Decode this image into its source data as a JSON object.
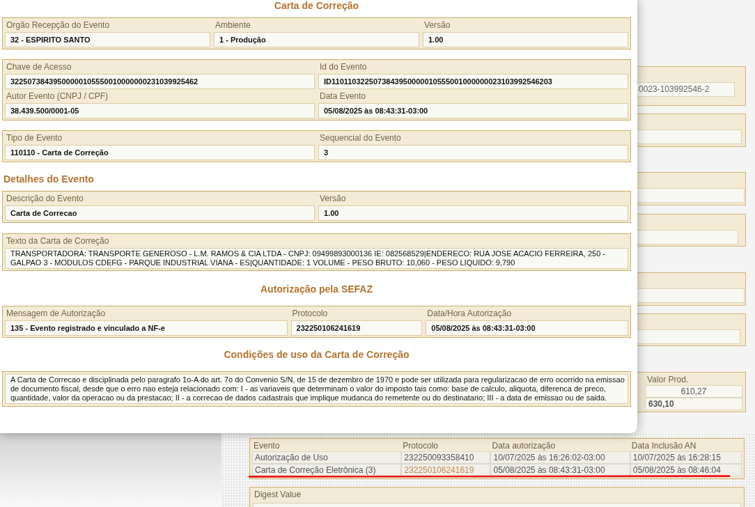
{
  "modal": {
    "title": "Carta de Correção",
    "blocks": [
      {
        "kind": "panel",
        "rows": [
          [
            {
              "kind": "input",
              "label": "Orgão Recepção do Evento",
              "value": "32 - ESPIRITO SANTO"
            },
            {
              "kind": "input",
              "label": "Ambiente",
              "value": "1 - Produção"
            },
            {
              "kind": "input",
              "label": "Versão",
              "value": "1.00"
            }
          ]
        ]
      },
      {
        "kind": "panel",
        "rows": [
          [
            {
              "kind": "input",
              "label": "Chave de Acesso",
              "value": "32250738439500000105550010000000231039925462"
            },
            {
              "kind": "input",
              "label": "Id do Evento",
              "value": "ID1101103225073843950000010555001000000023103992546203"
            }
          ],
          [
            {
              "kind": "input",
              "label": "Autor Evento (CNPJ / CPF)",
              "value": "38.439.500/0001-05"
            },
            {
              "kind": "input",
              "label": "Data Evento",
              "value": "05/08/2025 às 08:43:31-03:00"
            }
          ]
        ]
      },
      {
        "kind": "panel",
        "rows": [
          [
            {
              "kind": "input",
              "label": "Tipo de Evento",
              "value": "110110 - Carta de Correção"
            },
            {
              "kind": "input",
              "label": "Sequencial do Evento",
              "value": "3"
            }
          ]
        ]
      },
      {
        "kind": "heading",
        "text": "Detalhes do Evento"
      },
      {
        "kind": "panel",
        "rows": [
          [
            {
              "kind": "input",
              "label": "Descrição do Evento",
              "value": "Carta de Correcao"
            },
            {
              "kind": "input",
              "label": "Versão",
              "value": "1.00"
            }
          ]
        ]
      },
      {
        "kind": "panel",
        "rows": [
          [
            {
              "kind": "textarea",
              "label": "Texto da Carta de Correção",
              "value": "TRANSPORTADORA: TRANSPORTE GENEROSO - L.M. RAMOS & CIA LTDA - CNPJ: 09499893000136 IE: 082568529|ENDERECO: RUA JOSE ACACIO FERREIRA, 250 - GALPAO 3 - MODULOS CDEFG - PARQUE INDUSTRIAL VIANA - ES|QUANTIDADE: 1 VOLUME - PESO BRUTO: 10,060 - PESO LIQUIDO: 9,790"
            }
          ]
        ]
      },
      {
        "kind": "heading",
        "text": "Autorização pela SEFAZ"
      },
      {
        "kind": "panel",
        "rows": [
          [
            {
              "kind": "input",
              "label": "Mensagem de Autorização",
              "value": "135 - Evento registrado e vinculado a NF-e"
            },
            {
              "kind": "input",
              "label": "Protocolo",
              "value": "232250106241619"
            },
            {
              "kind": "input",
              "label": "Data/Hora Autorização",
              "value": "05/08/2025 às 08:43:31-03:00"
            }
          ]
        ]
      },
      {
        "kind": "heading",
        "text": "Condições de uso da Carta de Correção"
      },
      {
        "kind": "panel",
        "rows": [
          [
            {
              "kind": "textarea",
              "value": "A Carta de Correcao e disciplinada pelo paragrafo 1o-A do art. 7o do Convenio S/N, de 15 de dezembro de 1970 e pode ser utilizada para regularizacao de erro ocorrido na emissao de documento fiscal, desde que o erro nao esteja relacionado com: I - as variaveis que determinam o valor do imposto tais como: base de calculo, aliquota, diferenca de preco, quantidade, valor da operacao ou da prestacao; II - a correcao de dados cadastrais que implique mudanca do remetente ou do destinatario; III - a data de emissao ou de saida."
            }
          ]
        ]
      }
    ]
  },
  "background_page": {
    "panels": [
      {
        "kind": "form",
        "fields": [
          {
            "kind": "input",
            "value": "0023-103992546-2"
          }
        ]
      },
      {
        "kind": "form",
        "fields": [
          {
            "kind": "input"
          }
        ]
      },
      {
        "kind": "form",
        "fields": [
          {
            "kind": "input"
          }
        ]
      },
      {
        "kind": "form",
        "fields": [
          {
            "kind": "input"
          }
        ]
      },
      {
        "kind": "form",
        "fields": [
          {
            "kind": "input"
          }
        ]
      },
      {
        "kind": "form",
        "fields": [
          {
            "kind": "input"
          }
        ]
      },
      {
        "kind": "table",
        "columns": [
          "Valor Prod."
        ],
        "rows": [
          {
            "cells": [
              "610,27"
            ],
            "bold": false
          },
          {
            "cells": [
              "630,10"
            ],
            "bold": true
          }
        ]
      }
    ],
    "events": {
      "columns": [
        "Evento",
        "Protocolo",
        "Data autorização",
        "Data Inclusão AN"
      ],
      "rows": [
        {
          "cells": [
            "Autorização de Uso",
            "232250093358410",
            "10/07/2025 às 16:26:02-03:00",
            "10/07/2025 às 16:28:15"
          ],
          "protocol_link": false,
          "marked": false
        },
        {
          "cells": [
            "Carta de Correção Eletrônica (3)",
            "232250106241619",
            "05/08/2025 às 08:43:31-03:00",
            "05/08/2025 às 08:46:04"
          ],
          "protocol_link": true,
          "marked": true
        }
      ]
    },
    "digest": {
      "label": "Digest Value",
      "fields": [
        {
          "kind": "input"
        }
      ]
    }
  }
}
